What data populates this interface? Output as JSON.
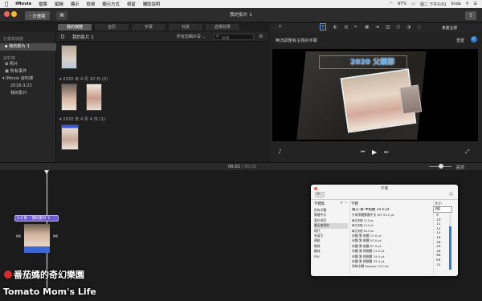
{
  "menubar": {
    "apple": "",
    "app": "iMovie",
    "items": [
      "檔案",
      "編輯",
      "標示",
      "檢視",
      "顯示方式",
      "視窗",
      "輔助說明"
    ],
    "status": {
      "battery": "97%",
      "datetime": "週二 下午5:01",
      "user": "linda"
    }
  },
  "toolbar": {
    "project_button": "計畫案",
    "title": "我的影片 1"
  },
  "tabs": [
    "我的媒體",
    "音訊",
    "字幕",
    "背景",
    "過場效果"
  ],
  "sidebar": {
    "header1": "計畫案媒體",
    "project": "我的影片 1",
    "header2": "資料庫",
    "items": [
      "照片",
      "所有事件",
      "iMovie 資料庫",
      "2018-3-22",
      "我的影片"
    ]
  },
  "browser": {
    "project_label": "我的影片 1",
    "filter": "所有剪輯片段",
    "search_placeholder": "搜尋",
    "group1": "2020 年 4 月 20 日",
    "group1_count": "(2)",
    "group2": "2020 年 4 月 4 日",
    "group2_count": "(1)"
  },
  "viewer": {
    "message": "無法調整有主題的字幕",
    "reset": "重置全部",
    "done": "重置",
    "overlay_title": "2020 父親節"
  },
  "timeline": {
    "timecode": "00:01",
    "total": "/ 00:02",
    "settings": "設定",
    "clip_title": "2.9 秒 – 我的影片 1"
  },
  "fontpanel": {
    "title": "字體",
    "col1_header": "字體集",
    "col2_header": "字體",
    "col3_header": "大小",
    "size_value": "86",
    "collections": [
      "所有字體",
      "繁體中文",
      "喜好項目",
      "最近使用的",
      "現代",
      "有寬字",
      "傳統",
      "網頁",
      "趣味",
      "PDF"
    ],
    "fonts": [
      "蘋方-繁 中粗體 24.0 pt.",
      "冬青黑體繁體中文 W3 53.0 pt.",
      "華文宋體 13.0 pt.",
      "華文宋體 24.0 pt.",
      "華文宋體 64.0 pt.",
      "宋體-繁 細體 13.0 pt.",
      "宋體-繁 細體 53.0 pt.",
      "宋體-繁 細體 67.0 pt.",
      "宋體-繁 標楷體 13.0 pt.",
      "宋體-繁 標楷體 24.0 pt.",
      "宋體-繁 標楷體 53.0 pt.",
      "系統字體 Regular 53.0 pt."
    ],
    "sizes": [
      "9",
      "10",
      "11",
      "12",
      "13",
      "14",
      "18",
      "24",
      "36",
      "48",
      "64",
      "72"
    ]
  },
  "watermark": {
    "line1": "番茄媽的奇幻樂園",
    "line2": "Tomato Mom's Life"
  },
  "colors": {
    "accent": "#2a7fd4",
    "clip_blue": "#3e68d8",
    "red": "#d92b2b"
  }
}
